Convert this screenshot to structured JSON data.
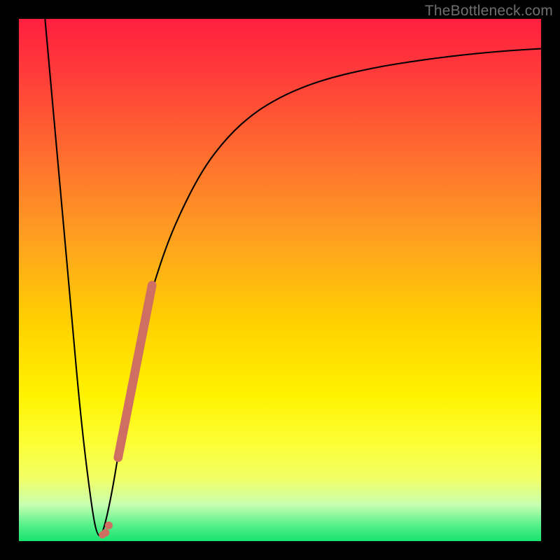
{
  "watermark": "TheBottleneck.com",
  "chart_data": {
    "type": "line",
    "title": "",
    "xlabel": "",
    "ylabel": "",
    "xlim": [
      0,
      100
    ],
    "ylim": [
      0,
      100
    ],
    "grid": false,
    "series": [
      {
        "name": "curve",
        "color": "#000000",
        "x": [
          5,
          8,
          10,
          12,
          14,
          15,
          16,
          18,
          20,
          22,
          24,
          27,
          30,
          35,
          40,
          45,
          50,
          55,
          60,
          65,
          70,
          75,
          80,
          85,
          90,
          95,
          100
        ],
        "y": [
          100,
          67,
          44,
          22,
          6,
          1,
          1,
          10,
          23,
          34,
          43,
          53,
          61,
          71,
          77.5,
          82,
          85,
          87.2,
          88.8,
          90,
          91,
          91.8,
          92.5,
          93.1,
          93.6,
          94,
          94.3
        ]
      },
      {
        "name": "highlight-segment",
        "color": "#cf6f63",
        "x": [
          16.0,
          16.6,
          17.2,
          19,
          24,
          25.5
        ],
        "y": [
          1.2,
          1.6,
          3.0,
          16,
          43,
          49
        ]
      }
    ],
    "background_gradient": {
      "direction": "vertical",
      "stops": [
        {
          "pos": 0.0,
          "color": "#ff1f3f"
        },
        {
          "pos": 0.58,
          "color": "#ffd000"
        },
        {
          "pos": 0.82,
          "color": "#fcff3a"
        },
        {
          "pos": 1.0,
          "color": "#17e46e"
        }
      ]
    }
  }
}
